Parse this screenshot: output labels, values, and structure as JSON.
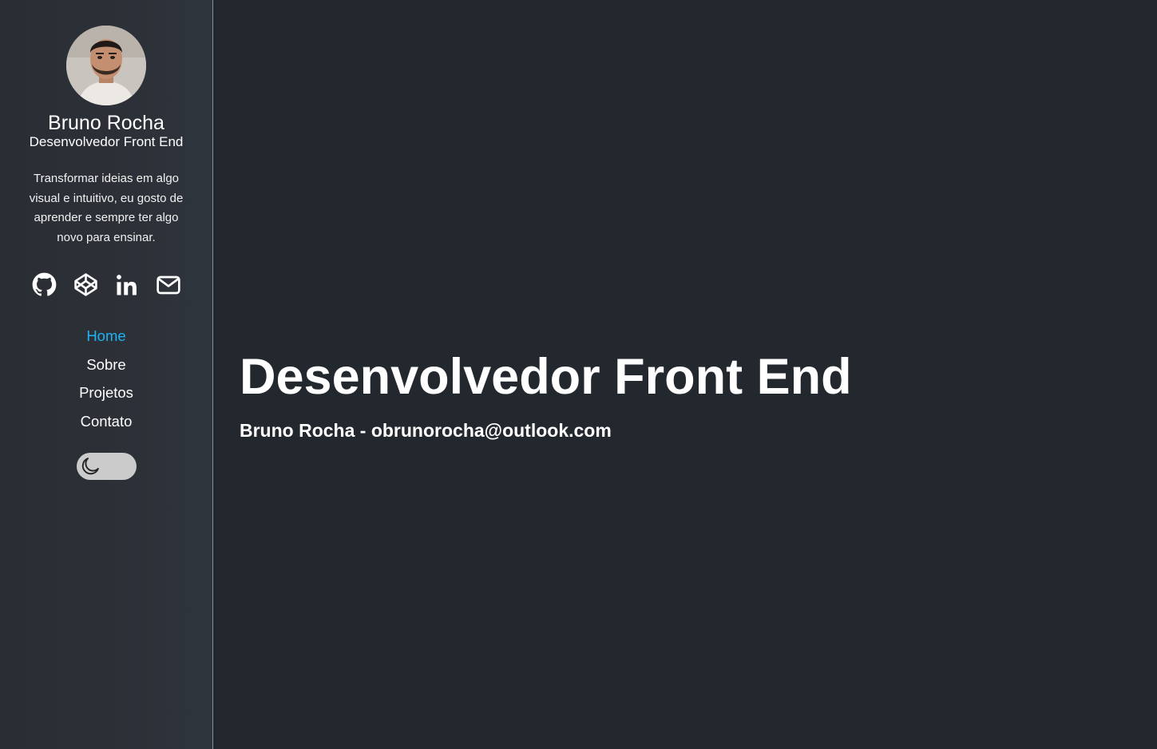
{
  "sidebar": {
    "name": "Bruno Rocha",
    "role": "Desenvolvedor Front End",
    "bio": "Transformar ideias em algo visual e intuitivo, eu gosto de aprender e sempre ter algo novo para ensinar.",
    "socials": [
      {
        "icon": "github-icon"
      },
      {
        "icon": "codepen-icon"
      },
      {
        "icon": "linkedin-icon"
      },
      {
        "icon": "mail-icon"
      }
    ],
    "nav": [
      {
        "label": "Home",
        "active": true
      },
      {
        "label": "Sobre",
        "active": false
      },
      {
        "label": "Projetos",
        "active": false
      },
      {
        "label": "Contato",
        "active": false
      }
    ],
    "theme_toggle": {
      "icon": "moon-icon"
    }
  },
  "hero": {
    "title": "Desenvolvedor Front End",
    "subtitle": "Bruno Rocha - obrunorocha@outlook.com"
  },
  "colors": {
    "background": "#23272e",
    "sidebar": "#2c3037",
    "accent": "#1eb3f3",
    "text": "#ffffff",
    "toggle": "#cbcbcb"
  }
}
